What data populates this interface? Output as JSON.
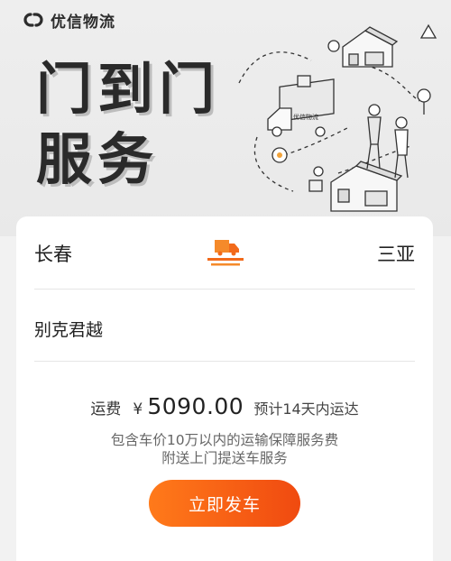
{
  "brand": {
    "name": "优信物流",
    "icon": "link-logo-icon"
  },
  "banner": {
    "headline_line1": "门到门",
    "headline_line2": "服务",
    "truck_sign": "优信物流"
  },
  "route": {
    "from_city": "长春",
    "to_city": "三亚",
    "icon": "truck-icon"
  },
  "vehicle": {
    "model": "别克君越"
  },
  "fee": {
    "label": "运费",
    "currency": "¥",
    "amount": "5090.00",
    "eta": "预计14天内运达",
    "note1": "包含车价10万以内的运输保障服务费",
    "note2": "附送上门提送车服务"
  },
  "actions": {
    "submit_label": "立即发车"
  },
  "colors": {
    "accent": "#f26a1b",
    "accent_end": "#f04a10"
  }
}
